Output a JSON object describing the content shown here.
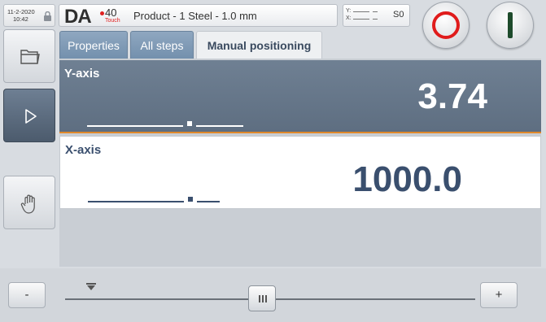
{
  "header": {
    "date": "11-2-2020",
    "time": "10:42",
    "logo_main": "DA",
    "logo_model": "40",
    "logo_sub": "Touch",
    "product": "Product - 1  Steel - 1.0 mm",
    "axis_status": {
      "y_label": "Y:",
      "x_label": "X:",
      "step": "S0"
    }
  },
  "sidebar": {
    "items": [
      {
        "name": "folder-icon",
        "active": false
      },
      {
        "name": "play-icon",
        "active": true
      },
      {
        "name": "hand-icon",
        "active": false
      }
    ]
  },
  "tabs": [
    {
      "label": "Properties",
      "active": false
    },
    {
      "label": "All steps",
      "active": false
    },
    {
      "label": "Manual positioning",
      "active": true
    }
  ],
  "axes": {
    "y": {
      "label": "Y-axis",
      "value": "3.74"
    },
    "x": {
      "label": "X-axis",
      "value": "1000.0"
    }
  },
  "slider": {
    "minus_label": "-",
    "plus_label": "+",
    "thumb_label": "III"
  },
  "colors": {
    "accent_orange": "#e08a2c",
    "stop_red": "#e01c1c",
    "start_green": "#1e4b2c",
    "tab_blue": "#7390ad",
    "panel_slate": "#5e6e81"
  }
}
